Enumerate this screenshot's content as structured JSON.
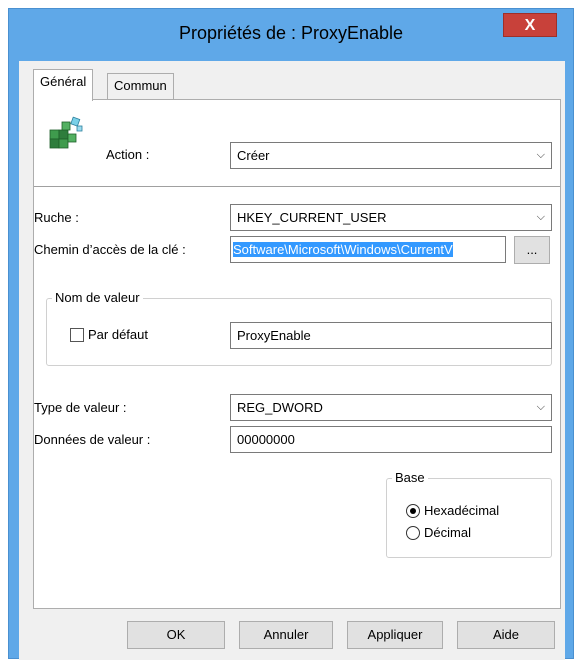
{
  "window": {
    "title": "Propriétés de : ProxyEnable",
    "close_glyph": "X"
  },
  "tabs": [
    {
      "label": "Général"
    },
    {
      "label": "Commun"
    }
  ],
  "general": {
    "icon": "registry-cubes-icon",
    "action_label": "Action :",
    "action_value": "Créer",
    "hive_label": "Ruche :",
    "hive_value": "HKEY_CURRENT_USER",
    "keypath_label": "Chemin d’accès de la clé :",
    "keypath_value": "Software\\Microsoft\\Windows\\CurrentV",
    "browse_label": "...",
    "value_name_group": "Nom de valeur",
    "default_label": "Par défaut",
    "value_name": "ProxyEnable",
    "value_type_label": "Type de valeur :",
    "value_type": "REG_DWORD",
    "value_data_label": "Données de valeur :",
    "value_data": "00000000",
    "base_group": "Base",
    "base_hex_label": "Hexadécimal",
    "base_dec_label": "Décimal",
    "base_selected": "Hexadécimal"
  },
  "buttons": {
    "ok": "OK",
    "cancel": "Annuler",
    "apply": "Appliquer",
    "help": "Aide"
  }
}
